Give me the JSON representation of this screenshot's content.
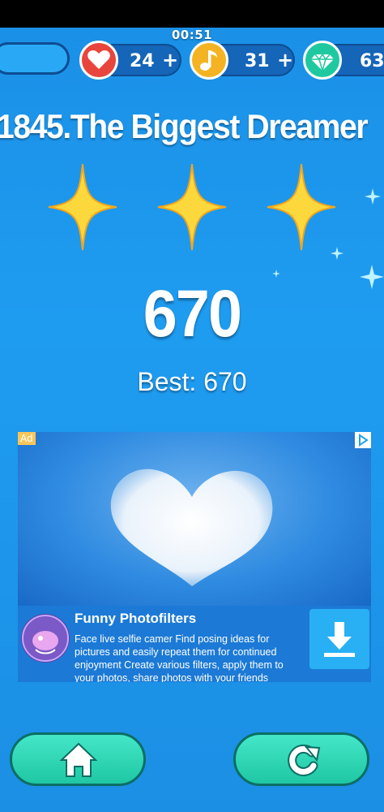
{
  "hud": {
    "timer": "00:51",
    "lives": {
      "value": "24",
      "plus": "+"
    },
    "notes": {
      "value": "31",
      "plus": "+"
    },
    "diamonds": {
      "value": "63"
    }
  },
  "result": {
    "song_title": "1845.The Biggest Dreamer",
    "stars_earned": 3,
    "stars_total": 3,
    "score": "670",
    "best": "Best: 670"
  },
  "ad": {
    "tag": "Ad",
    "app_name": "Funny Photofilters",
    "description": "Face live selfie camer Find posing ideas for pictures and easily repeat them for continued enjoyment Create various filters, apply them to your photos, share photos with your friends",
    "icons": [
      "ad-choices-icon",
      "download-icon",
      "chameleon-logo"
    ]
  },
  "nav": {
    "home_icon": "home-icon",
    "replay_icon": "replay-icon"
  },
  "colors": {
    "background": "#1e9cf0",
    "heart": "#e8453c",
    "note": "#f4b323",
    "diamond": "#1fc9a0",
    "button": "#2fd8b4",
    "star": "#fcd83c"
  }
}
